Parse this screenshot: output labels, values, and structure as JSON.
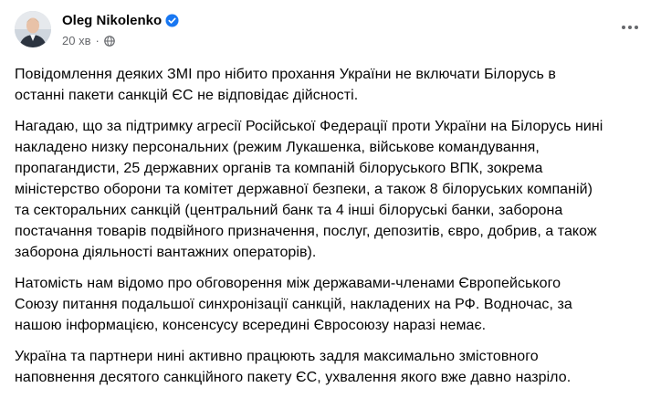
{
  "post": {
    "author": {
      "name": "Oleg Nikolenko",
      "verified": true
    },
    "meta": {
      "time": "20 хв",
      "separator": "·",
      "privacy_icon": "globe-icon"
    },
    "more_icon": "more-horizontal-icon",
    "paragraphs": [
      [
        "Повідомлення деяких ЗМІ про нібито прохання України не включати Білорусь в",
        "останні пакети санкцій ЄС не відповідає дійсності."
      ],
      [
        "Нагадаю, що за підтримку агресії Російської Федерації проти України на Білорусь нині",
        "накладено низку персональних (режим Лукашенка, військове командування,",
        "пропагандисти, 25 державних органів та компаній білоруського ВПК, зокрема",
        "міністерство оборони та комітет державної безпеки, а також 8 білоруських компаній)",
        "та секторальних санкцій (центральний банк та 4 інші білоруські банки, заборона",
        "постачання товарів подвійного призначення, послуг, депозитів, євро, добрив, а також",
        "заборона діяльності вантажних операторів)."
      ],
      [
        "Натомість нам відомо про обговорення між державами-членами Європейського",
        "Союзу питання подальшої синхронізації санкцій, накладених на РФ. Водночас, за",
        "нашою інформацією, консенсусу всередині Євросоюзу наразі немає."
      ],
      [
        "Україна та партнери нині активно працюють задля максимально змістовного",
        "наповнення десятого санкційного пакету ЄС, ухвалення якого вже давно назріло."
      ]
    ],
    "colors": {
      "text": "#050505",
      "secondary": "#65676b",
      "verified": "#1877f2"
    }
  }
}
